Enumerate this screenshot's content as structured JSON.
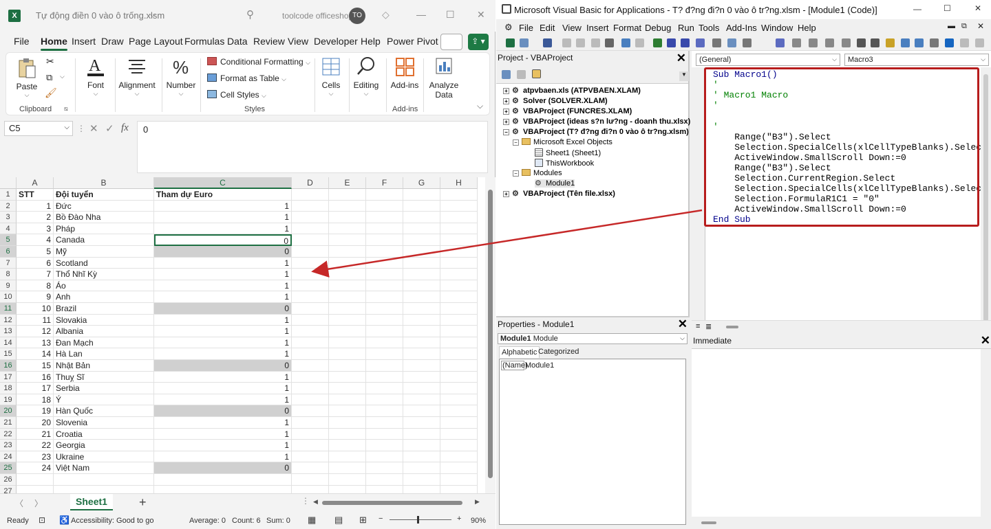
{
  "excel": {
    "window_title": "Tự động điền 0 vào ô trống.xlsm",
    "account_name": "toolcode officeshop",
    "account_initials": "TO",
    "menu": [
      "File",
      "Home",
      "Insert",
      "Draw",
      "Page Layout",
      "Formulas",
      "Data",
      "Review",
      "View",
      "Developer",
      "Help",
      "Power Pivot"
    ],
    "active_menu": "Home",
    "ribbon": {
      "paste": "Paste",
      "clipboard": "Clipboard",
      "font": "Font",
      "alignment": "Alignment",
      "number": "Number",
      "conditional_formatting": "Conditional Formatting",
      "format_as_table": "Format as Table",
      "cell_styles": "Cell Styles",
      "styles": "Styles",
      "cells": "Cells",
      "editing": "Editing",
      "addins": "Add-ins",
      "addins_group": "Add-ins",
      "analyze_data": "Analyze Data"
    },
    "name_box": "C5",
    "formula_value": "0",
    "columns": [
      "A",
      "B",
      "C",
      "D",
      "E",
      "F",
      "G",
      "H"
    ],
    "selected_column": "C",
    "header_row": {
      "stt": "STT",
      "team": "Đội tuyển",
      "euro": "Tham dự Euro"
    },
    "rows": [
      {
        "stt": "1",
        "team": "Đức",
        "euro": "1"
      },
      {
        "stt": "2",
        "team": "Bồ Đào Nha",
        "euro": "1"
      },
      {
        "stt": "3",
        "team": "Pháp",
        "euro": "1"
      },
      {
        "stt": "4",
        "team": "Canada",
        "euro": "0"
      },
      {
        "stt": "5",
        "team": "Mỹ",
        "euro": "0"
      },
      {
        "stt": "6",
        "team": "Scotland",
        "euro": "1"
      },
      {
        "stt": "7",
        "team": "Thổ Nhĩ Kỳ",
        "euro": "1"
      },
      {
        "stt": "8",
        "team": "Áo",
        "euro": "1"
      },
      {
        "stt": "9",
        "team": "Anh",
        "euro": "1"
      },
      {
        "stt": "10",
        "team": "Brazil",
        "euro": "0"
      },
      {
        "stt": "11",
        "team": "Slovakia",
        "euro": "1"
      },
      {
        "stt": "12",
        "team": "Albania",
        "euro": "1"
      },
      {
        "stt": "13",
        "team": "Đan Mạch",
        "euro": "1"
      },
      {
        "stt": "14",
        "team": "Hà Lan",
        "euro": "1"
      },
      {
        "stt": "15",
        "team": "Nhật Bản",
        "euro": "0"
      },
      {
        "stt": "16",
        "team": "Thuỵ Sĩ",
        "euro": "1"
      },
      {
        "stt": "17",
        "team": "Serbia",
        "euro": "1"
      },
      {
        "stt": "18",
        "team": "Ý",
        "euro": "1"
      },
      {
        "stt": "19",
        "team": "Hàn Quốc",
        "euro": "0"
      },
      {
        "stt": "20",
        "team": "Slovenia",
        "euro": "1"
      },
      {
        "stt": "21",
        "team": "Croatia",
        "euro": "1"
      },
      {
        "stt": "22",
        "team": "Georgia",
        "euro": "1"
      },
      {
        "stt": "23",
        "team": "Ukraine",
        "euro": "1"
      },
      {
        "stt": "24",
        "team": "Việt Nam",
        "euro": "0"
      }
    ],
    "row_numbers": [
      "1",
      "2",
      "3",
      "4",
      "5",
      "6",
      "7",
      "8",
      "9",
      "10",
      "11",
      "12",
      "13",
      "14",
      "15",
      "16",
      "17",
      "18",
      "19",
      "20",
      "21",
      "22",
      "23",
      "24",
      "25",
      "26",
      "27"
    ],
    "sheet_tab": "Sheet1",
    "status": {
      "ready": "Ready",
      "accessibility": "Accessibility: Good to go",
      "average": "Average: 0",
      "count": "Count: 6",
      "sum": "Sum: 0",
      "zoom": "90%"
    }
  },
  "vba": {
    "window_title": "Microsoft Visual Basic for Applications - T? đ?ng đi?n 0 vào ô tr?ng.xlsm - [Module1 (Code)]",
    "menu": [
      "File",
      "Edit",
      "View",
      "Insert",
      "Format",
      "Debug",
      "Run",
      "Tools",
      "Add-Ins",
      "Window",
      "Help"
    ],
    "project_title": "Project - VBAProject",
    "tree": [
      "atpvbaen.xls (ATPVBAEN.XLAM)",
      "Solver (SOLVER.XLAM)",
      "VBAProject (FUNCRES.XLAM)",
      "VBAProject (ideas s?n lư?ng - doanh thu.xlsx)",
      "VBAProject (T? đ?ng đi?n 0 vào ô tr?ng.xlsm)",
      "Microsoft Excel Objects",
      "Sheet1 (Sheet1)",
      "ThisWorkbook",
      "Modules",
      "Module1",
      "VBAProject (Tên file.xlsx)"
    ],
    "properties_title": "Properties - Module1",
    "properties_object": "Module1",
    "properties_type": "Module",
    "prop_tabs": [
      "Alphabetic",
      "Categorized"
    ],
    "prop_name_key": "(Name)",
    "prop_name_value": "Module1",
    "combo_general": "(General)",
    "combo_proc": "Macro3",
    "code_lines": [
      "Sub Macro1()",
      "'",
      "' Macro1 Macro",
      "'",
      "",
      "'",
      "    Range(\"B3\").Select",
      "    Selection.SpecialCells(xlCellTypeBlanks).Select",
      "    ActiveWindow.SmallScroll Down:=0",
      "    Range(\"B3\").Select",
      "    Selection.CurrentRegion.Select",
      "    Selection.SpecialCells(xlCellTypeBlanks).Select",
      "    Selection.FormulaR1C1 = \"0\"",
      "    ActiveWindow.SmallScroll Down:=0",
      "End Sub"
    ],
    "immediate_title": "Immediate"
  },
  "colors": {
    "excel_green": "#1d6f42",
    "annotation_red": "#b71c1c",
    "vba_keyword": "#00008b",
    "vba_comment": "#008000"
  }
}
